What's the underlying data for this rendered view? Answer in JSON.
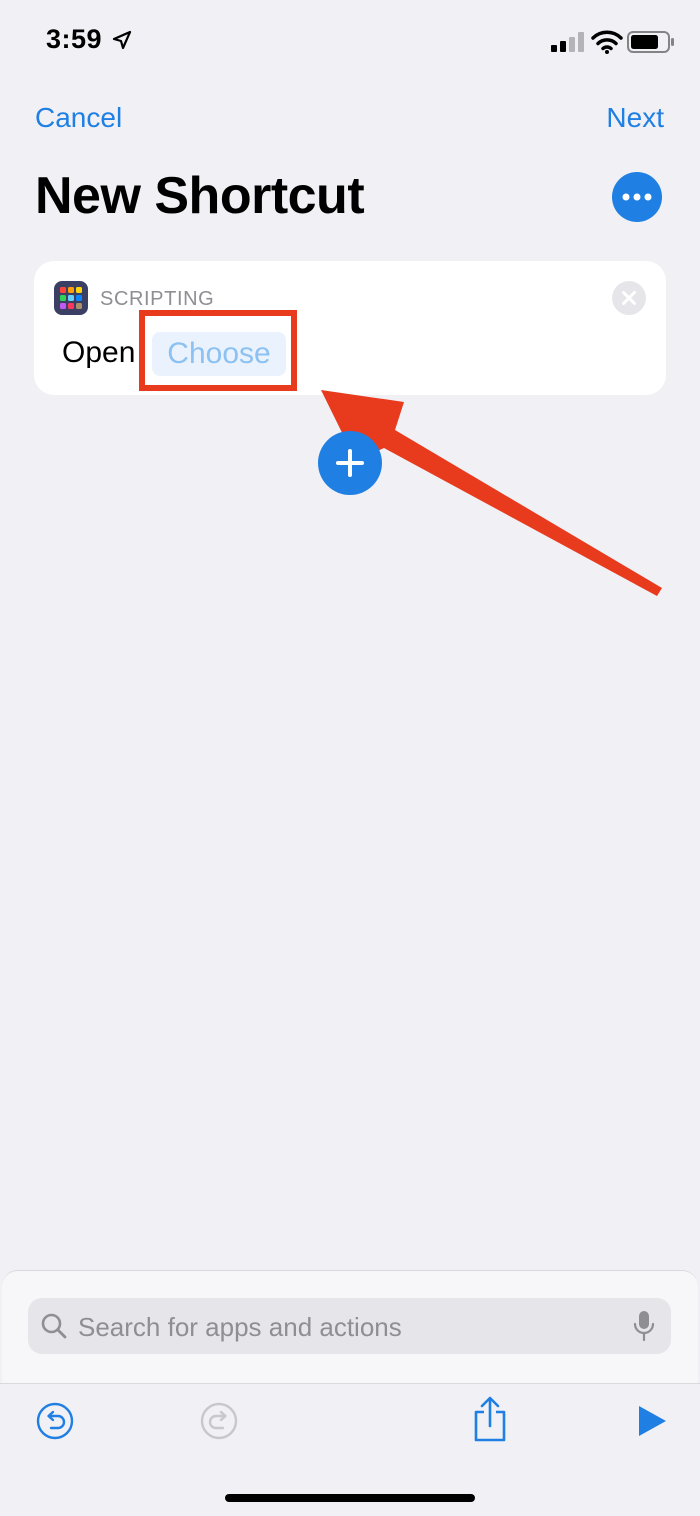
{
  "status_bar": {
    "time": "3:59"
  },
  "nav": {
    "cancel_label": "Cancel",
    "next_label": "Next"
  },
  "page": {
    "title": "New Shortcut"
  },
  "action_card": {
    "category": "SCRIPTING",
    "verb": "Open",
    "parameter_placeholder": "Choose"
  },
  "search": {
    "placeholder": "Search for apps and actions"
  },
  "icons": {
    "location": "location-arrow-icon",
    "signal": "cellular-signal-icon",
    "wifi": "wifi-icon",
    "battery": "battery-icon",
    "more": "ellipsis-icon",
    "app": "shortcuts-app-icon",
    "close": "close-icon",
    "add": "plus-icon",
    "search": "search-icon",
    "mic": "microphone-icon",
    "undo": "undo-icon",
    "redo": "redo-icon",
    "share": "share-icon",
    "play": "play-icon"
  },
  "colors": {
    "accent": "#1f7fe3",
    "annotation": "#e83a1d",
    "background": "#f0f0f5",
    "token_text": "#8cc1f2"
  }
}
